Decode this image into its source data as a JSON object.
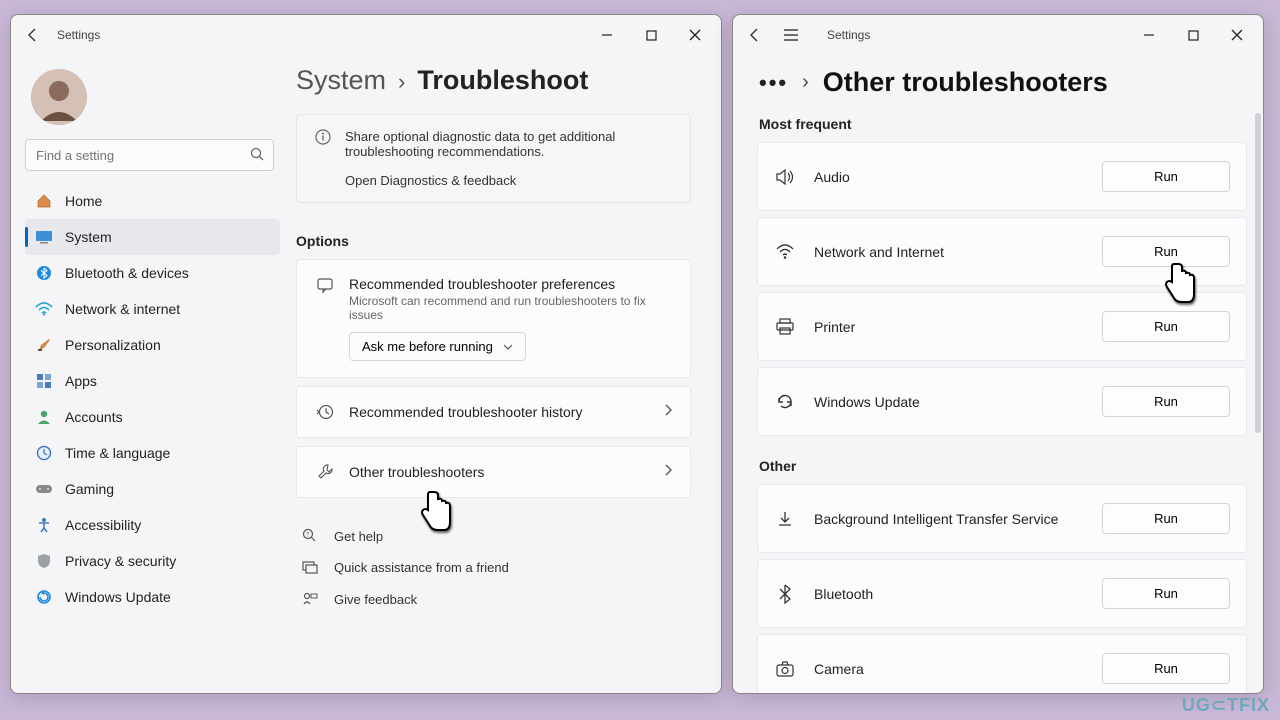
{
  "left": {
    "app_title": "Settings",
    "search_placeholder": "Find a setting",
    "nav": [
      {
        "label": "Home"
      },
      {
        "label": "System"
      },
      {
        "label": "Bluetooth & devices"
      },
      {
        "label": "Network & internet"
      },
      {
        "label": "Personalization"
      },
      {
        "label": "Apps"
      },
      {
        "label": "Accounts"
      },
      {
        "label": "Time & language"
      },
      {
        "label": "Gaming"
      },
      {
        "label": "Accessibility"
      },
      {
        "label": "Privacy & security"
      },
      {
        "label": "Windows Update"
      }
    ],
    "breadcrumb": {
      "parent": "System",
      "current": "Troubleshoot",
      "sep": "›"
    },
    "info": {
      "text": "Share optional diagnostic data to get additional troubleshooting recommendations.",
      "link": "Open Diagnostics & feedback"
    },
    "options_title": "Options",
    "pref": {
      "title": "Recommended troubleshooter preferences",
      "sub": "Microsoft can recommend and run troubleshooters to fix issues",
      "dropdown": "Ask me before running"
    },
    "history": "Recommended troubleshooter history",
    "other": "Other troubleshooters",
    "help": {
      "a": "Get help",
      "b": "Quick assistance from a friend",
      "c": "Give feedback"
    }
  },
  "right": {
    "app_title": "Settings",
    "header": "Other troubleshooters",
    "sep": "›",
    "sect1": "Most frequent",
    "sect2": "Other",
    "items1": [
      {
        "label": "Audio"
      },
      {
        "label": "Network and Internet"
      },
      {
        "label": "Printer"
      },
      {
        "label": "Windows Update"
      }
    ],
    "items2": [
      {
        "label": "Background Intelligent Transfer Service"
      },
      {
        "label": "Bluetooth"
      },
      {
        "label": "Camera"
      }
    ],
    "run": "Run"
  },
  "watermark": "UG⊂TFIX"
}
